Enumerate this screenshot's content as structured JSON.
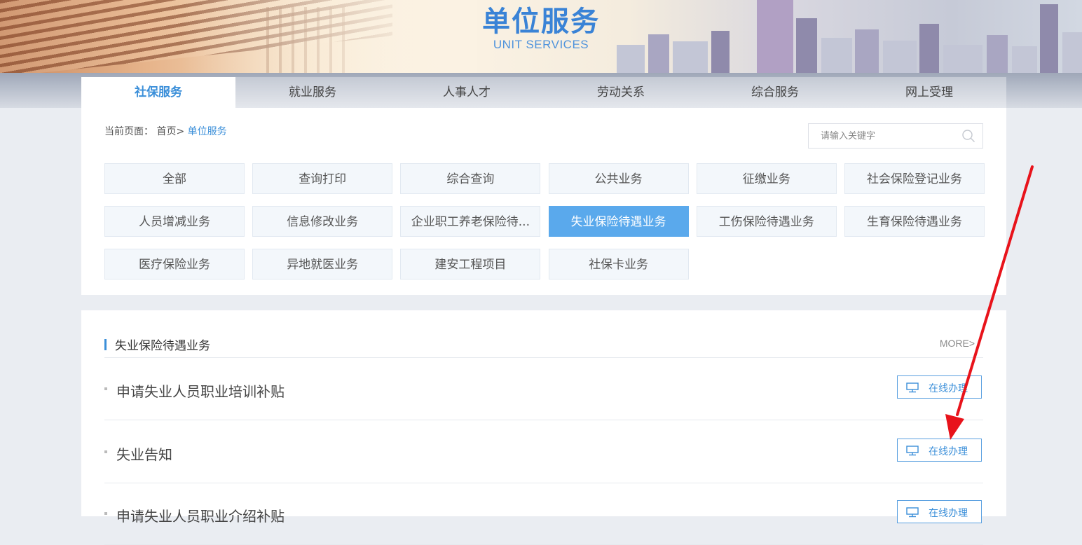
{
  "banner": {
    "title": "单位服务",
    "subtitle": "UNIT SERVICES"
  },
  "nav": {
    "tabs": [
      "社保服务",
      "就业服务",
      "人事人才",
      "劳动关系",
      "综合服务",
      "网上受理"
    ],
    "active_index": 0
  },
  "breadcrumb": {
    "prefix": "当前页面：",
    "home": "首页>",
    "current": "单位服务"
  },
  "search": {
    "placeholder": "请输入关键字",
    "icon": "search-icon"
  },
  "categories": [
    "全部",
    "查询打印",
    "综合查询",
    "公共业务",
    "征缴业务",
    "社会保险登记业务",
    "人员增减业务",
    "信息修改业务",
    "企业职工养老保险待...",
    "失业保险待遇业务",
    "工伤保险待遇业务",
    "生育保险待遇业务",
    "医疗保险业务",
    "异地就医业务",
    "建安工程项目",
    "社保卡业务"
  ],
  "active_category": "失业保险待遇业务",
  "section": {
    "title": "失业保险待遇业务",
    "more": "MORE>",
    "items": [
      {
        "name": "申请失业人员职业培训补贴",
        "button": "在线办理"
      },
      {
        "name": "失业告知",
        "button": "在线办理"
      },
      {
        "name": "申请失业人员职业介绍补贴",
        "button": "在线办理"
      }
    ]
  },
  "colors": {
    "accent": "#3b8fd9",
    "active_category_bg": "#5aa9ec",
    "annotation_arrow": "#e8131b"
  }
}
